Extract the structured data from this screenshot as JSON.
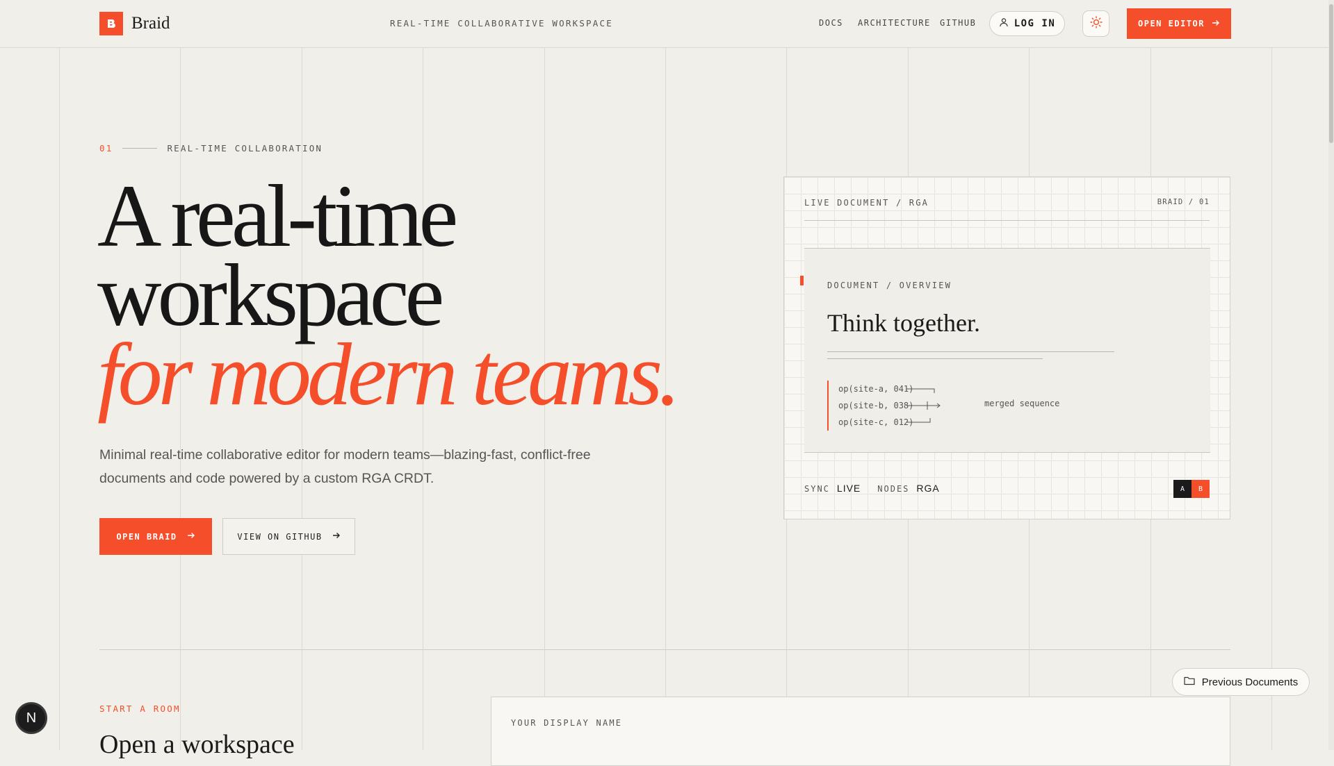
{
  "header": {
    "brand": "Braid",
    "tagline": "REAL-TIME COLLABORATIVE WORKSPACE",
    "nav": [
      "DOCS",
      "ARCHITECTURE",
      "GITHUB"
    ],
    "login_label": "LOG IN",
    "open_editor_label": "OPEN EDITOR"
  },
  "hero": {
    "index": "01",
    "eyebrow": "REAL-TIME COLLABORATION",
    "title_line1": "A real-time",
    "title_line2": "workspace",
    "title_accent": "for modern teams.",
    "lead": "Minimal real-time collaborative editor for modern teams—blazing-fast, conflict-free documents and code powered by a custom RGA CRDT.",
    "primary_cta": "OPEN BRAID",
    "secondary_cta": "VIEW ON GITHUB"
  },
  "preview": {
    "label_left": "LIVE DOCUMENT / RGA",
    "label_right": "BRAID / 01",
    "doc_label": "DOCUMENT / OVERVIEW",
    "doc_title": "Think together.",
    "ops": [
      "op(site-a, 041)",
      "op(site-b, 038)",
      "op(site-c, 012)"
    ],
    "merged_label": "merged sequence",
    "sync_key": "SYNC",
    "sync_value": "LIVE",
    "nodes_key": "NODES",
    "nodes_value": "RGA",
    "badges": [
      "A",
      "B"
    ]
  },
  "start": {
    "label": "START A ROOM",
    "title": "Open a workspace",
    "field_label": "YOUR DISPLAY NAME"
  },
  "floating": {
    "previous_documents": "Previous Documents",
    "dev_badge": "N"
  },
  "colors": {
    "accent": "#f54e2a",
    "background": "#f1efe9",
    "ink": "#1a1a1a"
  }
}
